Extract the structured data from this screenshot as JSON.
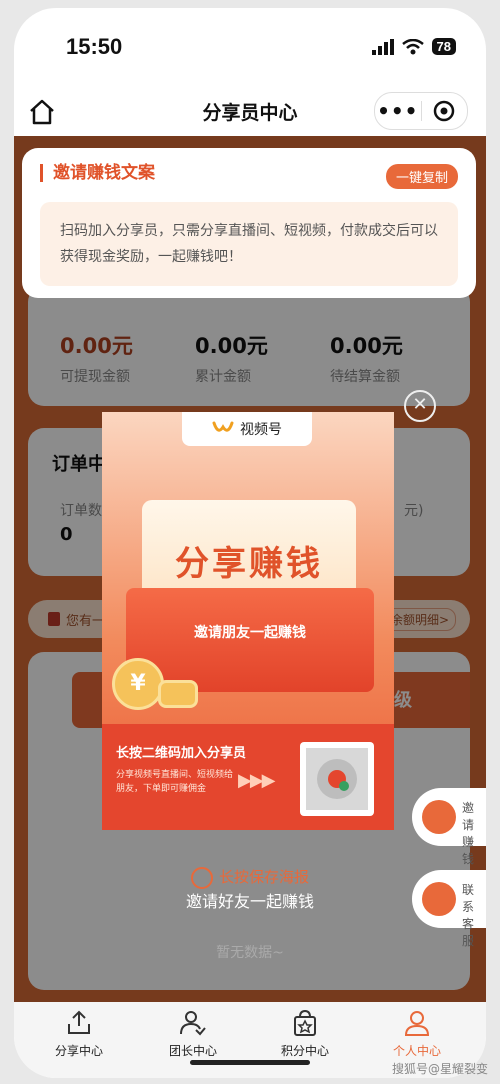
{
  "status_bar": {
    "time": "15:50",
    "battery": "78"
  },
  "nav": {
    "title": "分享员中心"
  },
  "invite_card": {
    "title": "邀请赚钱文案",
    "copy_button": "一键复制",
    "text": "扫码加入分享员，只需分享直播间、短视频，付款成交后可以获得现金奖励，一起赚钱吧！"
  },
  "earnings": [
    {
      "amount": "0.00元",
      "label": "可提现金额",
      "color": "#b04020"
    },
    {
      "amount": "0.00元",
      "label": "累计金额",
      "color": "#111111"
    },
    {
      "amount": "0.00元",
      "label": "待结算金额",
      "color": "#111111"
    }
  ],
  "orders": {
    "title": "订单中",
    "count_label": "订单数",
    "count_value": "0",
    "partial_right": "元)"
  },
  "notice": {
    "text": "您有一",
    "right": "余额明细>"
  },
  "level_partial": "级",
  "poster": {
    "header": "视频号",
    "title": "分享赚钱",
    "subtitle": "邀请朋友一起赚钱",
    "qr_title": "长按二维码加入分享员",
    "qr_desc": "分享视频号直播间、短视频给朋友，下单即可赚佣金"
  },
  "long_press": "长按保存海报",
  "invite_friends": "邀请好友一起赚钱",
  "no_data": "暂无数据~",
  "float_buttons": [
    {
      "label": "邀请赚钱",
      "icon": "user-money-icon"
    },
    {
      "label": "联系客服",
      "icon": "headset-icon"
    }
  ],
  "tabs": [
    {
      "label": "分享中心",
      "icon": "share-upload-icon",
      "active": false
    },
    {
      "label": "团长中心",
      "icon": "leader-icon",
      "active": false
    },
    {
      "label": "积分中心",
      "icon": "points-bag-icon",
      "active": false
    },
    {
      "label": "个人中心",
      "icon": "person-icon",
      "active": true
    }
  ],
  "watermark": "搜狐号@星耀裂变",
  "colors": {
    "accent": "#e8693a",
    "background": "#d86a36",
    "poster_red": "#e4462e"
  }
}
